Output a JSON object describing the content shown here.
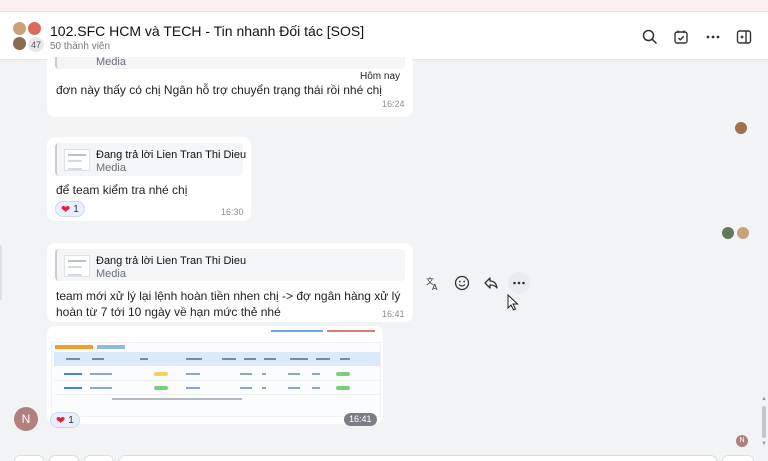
{
  "header": {
    "title": "102.SFC HCM và TECH - Tin nhanh Đối tác [SOS]",
    "members": "50 thành viên",
    "avatar_count": "47",
    "icons": [
      "search-icon",
      "task-icon",
      "more-icon",
      "sidebar-toggle-icon"
    ]
  },
  "messages": [
    {
      "quote_sub": "Media",
      "date_badge": "Hôm nay",
      "text": "đơn này thấy có chị Ngân hỗ trợ chuyển trạng thái rồi nhé chị",
      "time": "16:24"
    },
    {
      "quote_title": "Đang trả lời Lien Tran Thi Dieu",
      "quote_sub": "Media",
      "text": "để team kiểm tra nhé chị",
      "reaction": "1",
      "time": "16:30"
    },
    {
      "quote_title": "Đang trả lời Lien Tran Thi Dieu",
      "quote_sub": "Media",
      "text_line1": "team mới xử lý lại lệnh hoàn tiền nhen chị -> đợ ngân hàng xử lý",
      "text_line2": "hoàn từ 7 tới 10 ngày về hạn mức thẻ nhé",
      "time": "16:41"
    },
    {
      "type": "image",
      "reaction": "1",
      "time": "16:41",
      "avatar_letter": "N"
    }
  ],
  "actions": [
    "translate-icon",
    "emoji-icon",
    "reply-icon",
    "more-icon"
  ],
  "read_avatar_letter": "N",
  "colors": {
    "accent": "#0068ff",
    "heart": "#e0243a",
    "header_bg": "#ffffff",
    "chat_bg": "#f2f3f5"
  }
}
